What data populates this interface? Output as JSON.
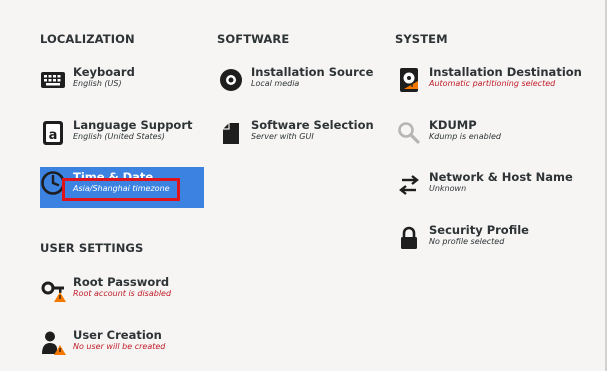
{
  "sections": {
    "localization": "LOCALIZATION",
    "software": "SOFTWARE",
    "system": "SYSTEM",
    "user_settings": "USER SETTINGS"
  },
  "spokes": {
    "keyboard": {
      "title": "Keyboard",
      "status": "English (US)",
      "icon": "keyboard-icon"
    },
    "language": {
      "title": "Language Support",
      "status": "English (United States)",
      "icon": "language-icon"
    },
    "time_date": {
      "title": "Time & Date",
      "status": "Asia/Shanghai timezone",
      "icon": "clock-icon"
    },
    "install_source": {
      "title": "Installation Source",
      "status": "Local media",
      "icon": "disc-icon"
    },
    "software_selection": {
      "title": "Software Selection",
      "status": "Server with GUI",
      "icon": "package-icon"
    },
    "install_dest": {
      "title": "Installation Destination",
      "status": "Automatic partitioning selected",
      "icon": "hard-drive-icon"
    },
    "kdump": {
      "title": "KDUMP",
      "status": "Kdump is enabled",
      "icon": "magnifier-icon"
    },
    "network": {
      "title": "Network & Host Name",
      "status": "Unknown",
      "icon": "network-arrows-icon"
    },
    "security": {
      "title": "Security Profile",
      "status": "No profile selected",
      "icon": "lock-icon"
    },
    "root_password": {
      "title": "Root Password",
      "status": "Root account is disabled",
      "icon": "key-warning-icon"
    },
    "user_creation": {
      "title": "User Creation",
      "status": "No user will be created",
      "icon": "user-warning-icon"
    }
  },
  "colors": {
    "selected": "#3c83e1",
    "warning_text": "#c01c28",
    "warning_badge": "#f57900",
    "highlight_box": "#e0121b"
  }
}
